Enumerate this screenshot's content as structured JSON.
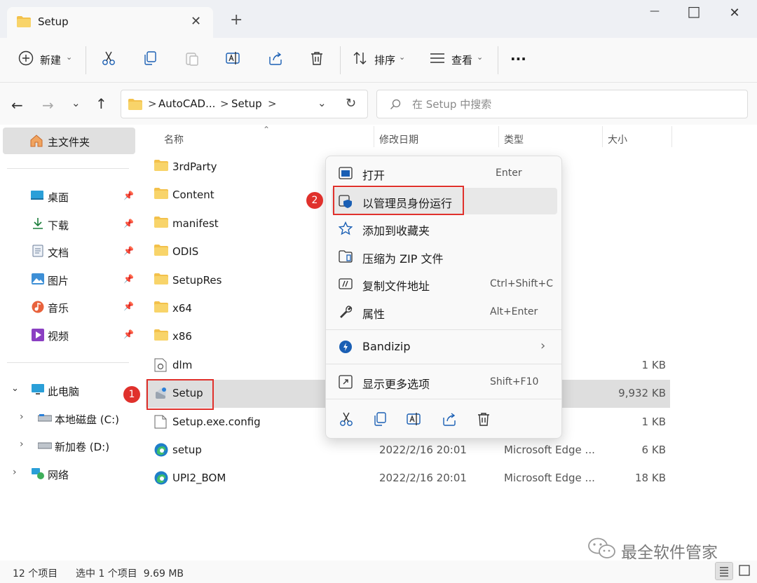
{
  "window": {
    "tab_title": "Setup",
    "close_tab": "✕",
    "new_tab": "+",
    "minimize": "—",
    "maximize": "□",
    "close": "✕"
  },
  "toolbar": {
    "new_label": "新建",
    "sort_label": "排序",
    "view_label": "查看",
    "more_label": "···"
  },
  "address": {
    "seg1": "AutoCAD...",
    "seg2": "Setup",
    "sep": ">",
    "search_placeholder": "在 Setup 中搜索"
  },
  "nav": {
    "home": "主文件夹",
    "quick": [
      {
        "label": "桌面"
      },
      {
        "label": "下载"
      },
      {
        "label": "文档"
      },
      {
        "label": "图片"
      },
      {
        "label": "音乐"
      },
      {
        "label": "视频"
      }
    ],
    "this_pc": "此电脑",
    "drive_c": "本地磁盘 (C:)",
    "drive_d": "新加卷 (D:)",
    "network": "网络"
  },
  "columns": {
    "name": "名称",
    "modified": "修改日期",
    "type": "类型",
    "size": "大小"
  },
  "files": [
    {
      "name": "3rdParty",
      "date": "",
      "type": "",
      "size": "",
      "icon": "folder"
    },
    {
      "name": "Content",
      "date": "",
      "type": "",
      "size": "",
      "icon": "folder"
    },
    {
      "name": "manifest",
      "date": "",
      "type": "",
      "size": "",
      "icon": "folder"
    },
    {
      "name": "ODIS",
      "date": "",
      "type": "",
      "size": "",
      "icon": "folder"
    },
    {
      "name": "SetupRes",
      "date": "",
      "type": "",
      "size": "",
      "icon": "folder"
    },
    {
      "name": "x64",
      "date": "",
      "type": "",
      "size": "",
      "icon": "folder"
    },
    {
      "name": "x86",
      "date": "",
      "type": "",
      "size": "",
      "icon": "folder"
    },
    {
      "name": "dlm",
      "date": "",
      "type": "",
      "size": "1 KB",
      "icon": "dll"
    },
    {
      "name": "Setup",
      "date": "",
      "type": "",
      "size": "9,932 KB",
      "icon": "setup-exe"
    },
    {
      "name": "Setup.exe.config",
      "date": "",
      "type": "件",
      "size": "1 KB",
      "icon": "file"
    },
    {
      "name": "setup",
      "date": "2022/2/16 20:01",
      "type": "Microsoft Edge ...",
      "size": "6 KB",
      "icon": "edge"
    },
    {
      "name": "UPI2_BOM",
      "date": "2022/2/16 20:01",
      "type": "Microsoft Edge ...",
      "size": "18 KB",
      "icon": "edge"
    }
  ],
  "menu": {
    "open": "打开",
    "open_key": "Enter",
    "run_admin": "以管理员身份运行",
    "add_fav": "添加到收藏夹",
    "zip": "压缩为 ZIP 文件",
    "copy_path": "复制文件地址",
    "copy_path_key": "Ctrl+Shift+C",
    "properties": "属性",
    "properties_key": "Alt+Enter",
    "bandizip": "Bandizip",
    "more_options": "显示更多选项",
    "more_options_key": "Shift+F10"
  },
  "annotations": {
    "step1": "1",
    "step2": "2"
  },
  "status": {
    "count": "12 个项目",
    "selected": "选中 1 个项目  9.69 MB"
  },
  "watermark": "最全软件管家",
  "colors": {
    "accent": "#0067c0",
    "folder": "#f3c14b",
    "annotation": "#e0312c",
    "selection": "#dedede"
  }
}
